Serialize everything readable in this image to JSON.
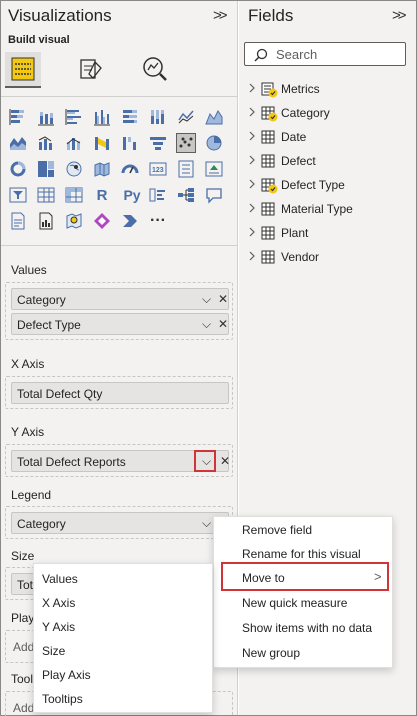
{
  "visualizations": {
    "title": "Visualizations",
    "build_visual_label": "Build visual",
    "build_icons": [
      "build-visual-icon",
      "format-visual-icon",
      "analytics-icon"
    ],
    "visual_icons": [
      "stacked-bar-icon",
      "stacked-column-icon",
      "clustered-bar-icon",
      "clustered-column-icon",
      "100-stacked-bar-icon",
      "100-stacked-column-icon",
      "line-chart-icon",
      "area-chart-icon",
      "stacked-area-icon",
      "line-clustered-column-icon",
      "line-stacked-column-icon",
      "ribbon-chart-icon",
      "waterfall-icon",
      "funnel-icon",
      "scatter-chart-icon",
      "pie-chart-icon",
      "donut-chart-icon",
      "treemap-icon",
      "map-icon",
      "filled-map-icon",
      "gauge-icon",
      "card-icon",
      "multirow-card-icon",
      "kpi-icon",
      "slicer-icon",
      "table-icon",
      "matrix-icon",
      "r-visual-icon",
      "python-visual-icon",
      "key-influencers-icon",
      "decomposition-tree-icon",
      "qa-icon",
      "smart-narrative-icon",
      "paginated-report-icon",
      "azure-map-icon",
      "power-apps-icon",
      "power-automate-icon",
      "more-visuals-icon"
    ],
    "r_label": "R",
    "py_label": "Py",
    "more_label": "···",
    "values_label": "Values",
    "values_fields": [
      "Category",
      "Defect Type"
    ],
    "x_axis_label": "X Axis",
    "x_axis_field": "Total Defect Qty",
    "y_axis_label": "Y Axis",
    "y_axis_field": "Total Defect Reports",
    "legend_label": "Legend",
    "legend_field": "Category",
    "size_label": "Size",
    "size_field_partial": "Tota",
    "play_label_partial": "Play",
    "play_field_partial": "Add",
    "tooltips_label_partial": "Tool",
    "tooltips_field_partial": "Add"
  },
  "fields": {
    "title": "Fields",
    "search_placeholder": "Search",
    "items": [
      {
        "label": "Metrics",
        "icon": "measure-table-icon",
        "checked": true
      },
      {
        "label": "Category",
        "icon": "table-icon",
        "checked": true
      },
      {
        "label": "Date",
        "icon": "table-icon",
        "checked": false
      },
      {
        "label": "Defect",
        "icon": "table-icon",
        "checked": false
      },
      {
        "label": "Defect Type",
        "icon": "table-icon",
        "checked": true
      },
      {
        "label": "Material Type",
        "icon": "table-icon",
        "checked": false
      },
      {
        "label": "Plant",
        "icon": "table-icon",
        "checked": false
      },
      {
        "label": "Vendor",
        "icon": "table-icon",
        "checked": false
      }
    ]
  },
  "context_menu": {
    "items": [
      "Remove field",
      "Rename for this visual",
      "Move to",
      "New quick measure",
      "Show items with no data",
      "New group"
    ],
    "highlighted": "Move to"
  },
  "submenu": {
    "items": [
      "Values",
      "X Axis",
      "Y Axis",
      "Size",
      "Play Axis",
      "Tooltips"
    ]
  },
  "colors": {
    "pane_bg": "#f3f2f1",
    "highlight_red": "#d13438",
    "checkmark_yellow": "#f2c811",
    "icon_blue": "#4a6fa8"
  }
}
